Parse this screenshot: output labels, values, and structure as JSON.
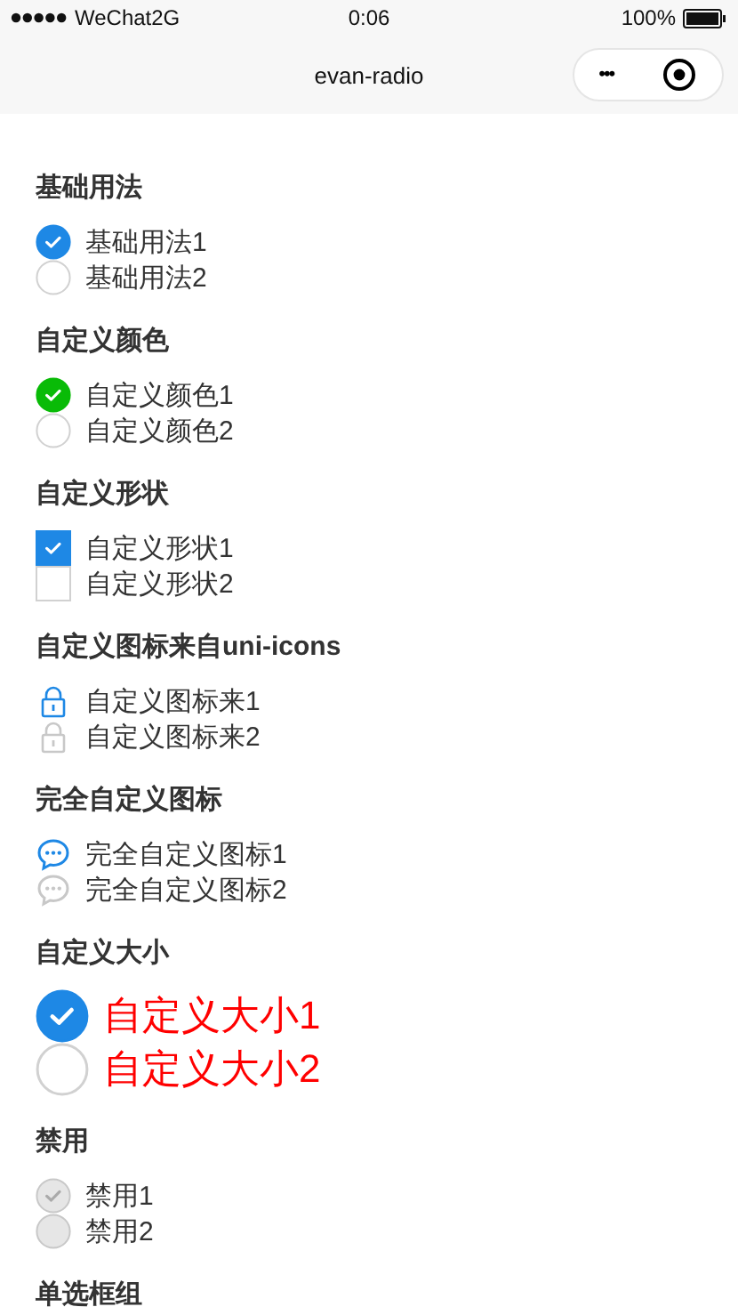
{
  "status_bar": {
    "carrier": "WeChat2G",
    "time": "0:06",
    "battery": "100%"
  },
  "nav": {
    "title": "evan-radio",
    "more": "•••"
  },
  "sections": [
    {
      "title": "基础用法",
      "kind": "circle",
      "color": "#1e88e5",
      "options": [
        {
          "label": "基础用法1",
          "selected": true
        },
        {
          "label": "基础用法2",
          "selected": false
        }
      ]
    },
    {
      "title": "自定义颜色",
      "kind": "circle",
      "color": "#09bb07",
      "options": [
        {
          "label": "自定义颜色1",
          "selected": true
        },
        {
          "label": "自定义颜色2",
          "selected": false
        }
      ]
    },
    {
      "title": "自定义形状",
      "kind": "square",
      "color": "#1e88e5",
      "options": [
        {
          "label": "自定义形状1",
          "selected": true
        },
        {
          "label": "自定义形状2",
          "selected": false
        }
      ]
    },
    {
      "title": "自定义图标来自uni-icons",
      "kind": "lock",
      "color": "#1e88e5",
      "options": [
        {
          "label": "自定义图标来1",
          "selected": true
        },
        {
          "label": "自定义图标来2",
          "selected": false
        }
      ]
    },
    {
      "title": "完全自定义图标",
      "kind": "chat",
      "color": "#1e88e5",
      "options": [
        {
          "label": "完全自定义图标1",
          "selected": true
        },
        {
          "label": "完全自定义图标2",
          "selected": false
        }
      ]
    },
    {
      "title": "自定义大小",
      "kind": "large",
      "color": "#1e88e5",
      "options": [
        {
          "label": "自定义大小1",
          "selected": true
        },
        {
          "label": "自定义大小2",
          "selected": false
        }
      ]
    },
    {
      "title": "禁用",
      "kind": "disabled",
      "options": [
        {
          "label": "禁用1",
          "selected": true
        },
        {
          "label": "禁用2",
          "selected": false
        }
      ]
    },
    {
      "title": "单选框组"
    }
  ]
}
